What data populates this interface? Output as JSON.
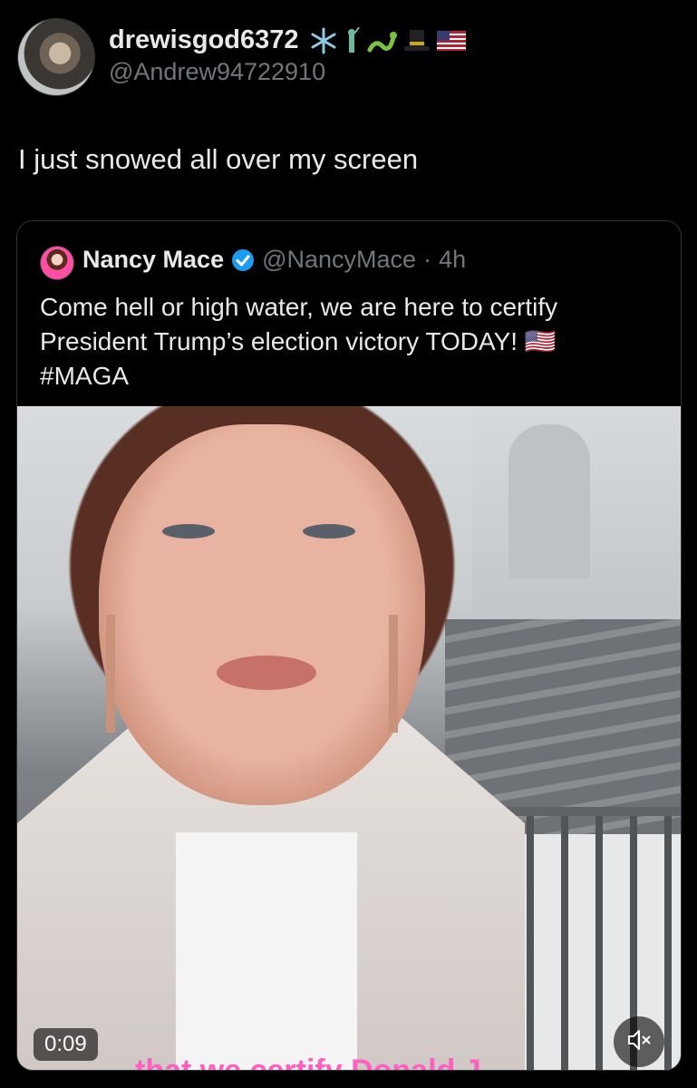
{
  "tweet": {
    "author_name": "drewisgod6372",
    "author_handle": "@Andrew94722910",
    "author_emojis": [
      "snowflake-icon",
      "statue-of-liberty-icon",
      "snake-icon",
      "top-hat-icon",
      "us-flag-icon"
    ],
    "text": "I just snowed all over my screen"
  },
  "quoted_tweet": {
    "author_name": "Nancy Mace",
    "author_handle": "@NancyMace",
    "separator": "·",
    "time": "4h",
    "text_line1": "Come hell or high water, we are here to certify",
    "text_line2": "President Trump’s election victory TODAY! 🇺🇸",
    "text_line3": "#MAGA",
    "verified_color": "#1d9bf0",
    "video": {
      "duration": "0:09",
      "caption": "that we certify Donald J",
      "caption_color": "#ff5fc1",
      "mute_icon": "speaker-muted-icon"
    }
  }
}
